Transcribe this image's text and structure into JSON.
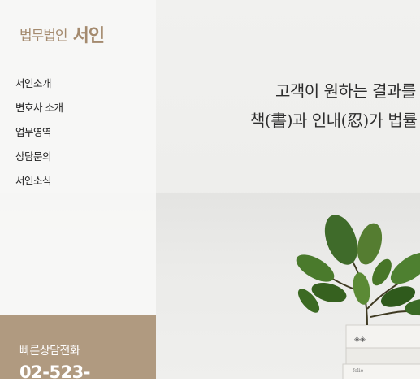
{
  "logo": {
    "prefix": "법무법인",
    "name": "서인"
  },
  "nav": {
    "items": [
      {
        "label": "서인소개"
      },
      {
        "label": "변호사 소개"
      },
      {
        "label": "업무영역"
      },
      {
        "label": "상담문의"
      },
      {
        "label": "서인소식"
      }
    ]
  },
  "hero": {
    "line1": "고객이 원하는 결과를",
    "line2": "책(書)과 인내(忍)가 법률"
  },
  "book": {
    "label": "folio"
  },
  "contact": {
    "label": "빠른상담전화",
    "phone": "02-523-"
  },
  "colors": {
    "accent": "#b09a80",
    "logo": "#a48a6e"
  }
}
